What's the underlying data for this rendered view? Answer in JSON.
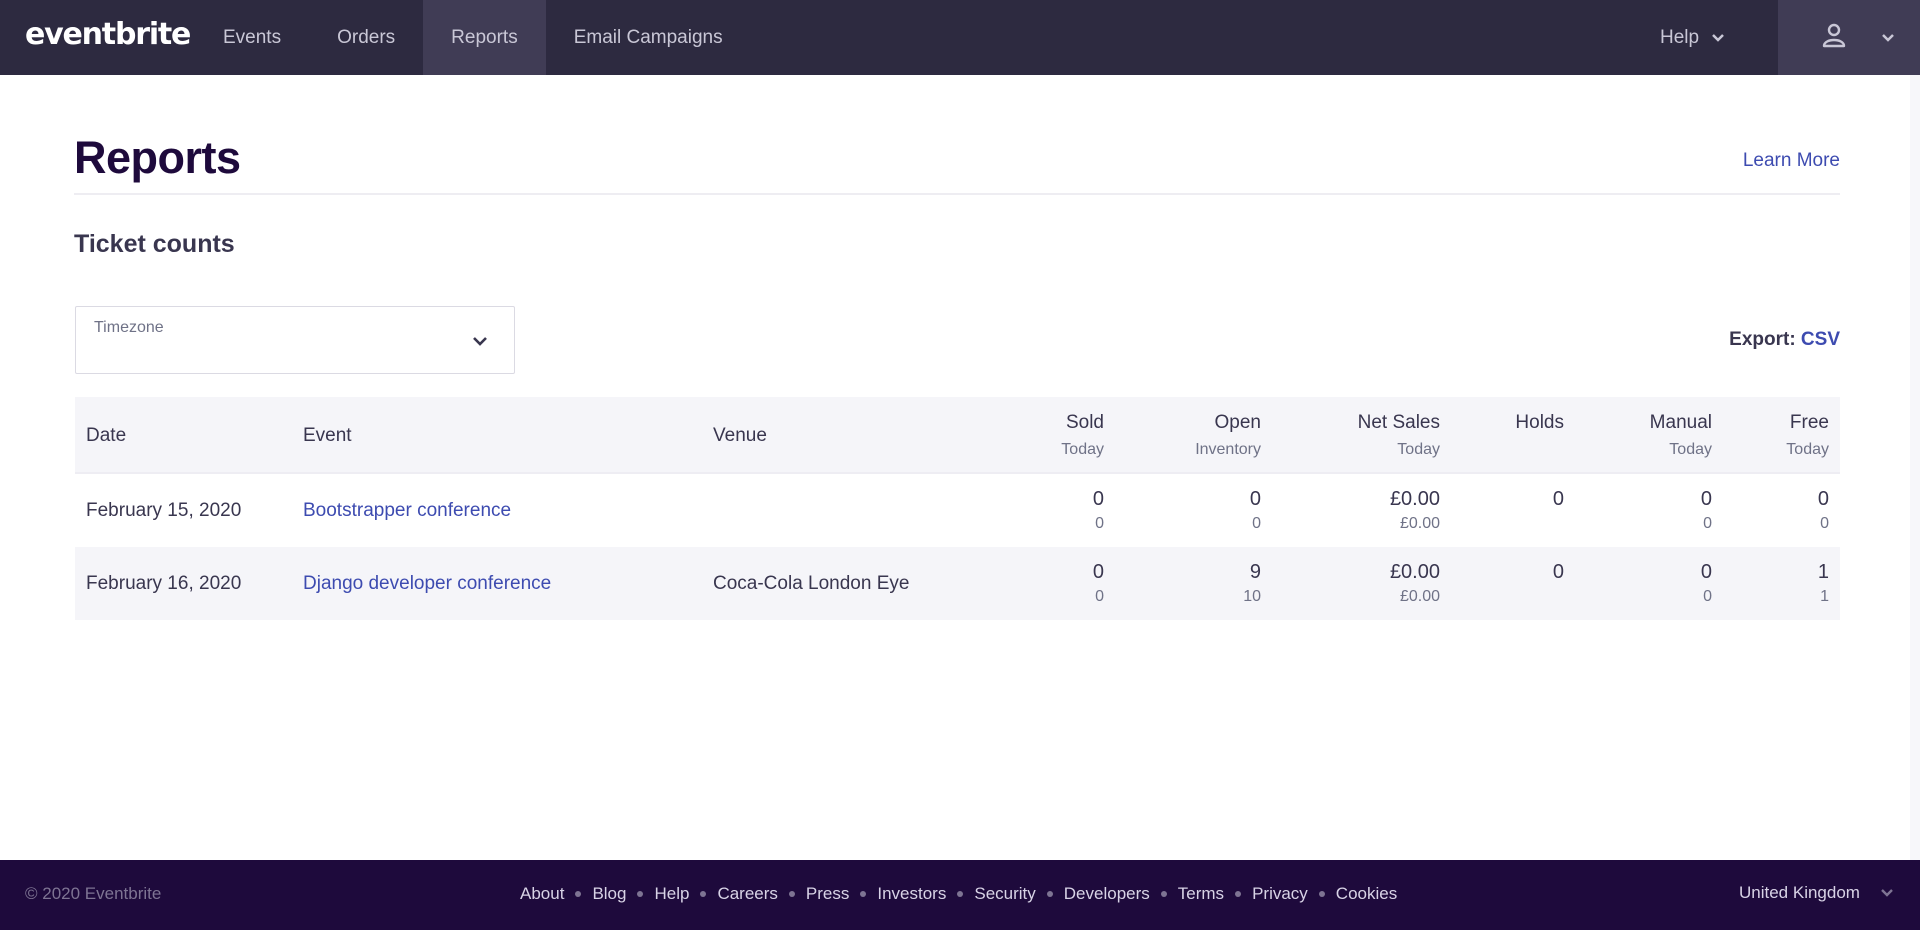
{
  "topbar": {
    "logo": "eventbrite",
    "nav": [
      {
        "label": "Events",
        "active": false
      },
      {
        "label": "Orders",
        "active": false
      },
      {
        "label": "Reports",
        "active": true
      },
      {
        "label": "Email Campaigns",
        "active": false
      }
    ],
    "help_label": "Help",
    "user_icon": "user-icon",
    "chevron_icon": "chevron-down-icon"
  },
  "page": {
    "title": "Reports",
    "learn_more": "Learn More",
    "section_title": "Ticket counts"
  },
  "timezone": {
    "label": "Timezone",
    "value": ""
  },
  "export": {
    "label": "Export:",
    "csv": "CSV"
  },
  "table": {
    "columns": [
      {
        "key": "date",
        "label": "Date",
        "sub": ""
      },
      {
        "key": "event",
        "label": "Event",
        "sub": ""
      },
      {
        "key": "venue",
        "label": "Venue",
        "sub": ""
      },
      {
        "key": "sold",
        "label": "Sold",
        "sub": "Today"
      },
      {
        "key": "open",
        "label": "Open",
        "sub": "Inventory"
      },
      {
        "key": "net",
        "label": "Net Sales",
        "sub": "Today"
      },
      {
        "key": "holds",
        "label": "Holds",
        "sub": ""
      },
      {
        "key": "manual",
        "label": "Manual",
        "sub": "Today"
      },
      {
        "key": "free",
        "label": "Free",
        "sub": "Today"
      }
    ],
    "rows": [
      {
        "date": "February 15, 2020",
        "event": "Bootstrapper conference",
        "venue": "",
        "sold": "0",
        "sold_sub": "0",
        "open": "0",
        "open_sub": "0",
        "net": "£0.00",
        "net_sub": "£0.00",
        "holds": "0",
        "manual": "0",
        "manual_sub": "0",
        "free": "0",
        "free_sub": "0"
      },
      {
        "date": "February 16, 2020",
        "event": "Django developer conference",
        "venue": "Coca-Cola London Eye",
        "sold": "0",
        "sold_sub": "0",
        "open": "9",
        "open_sub": "10",
        "net": "£0.00",
        "net_sub": "£0.00",
        "holds": "0",
        "manual": "0",
        "manual_sub": "0",
        "free": "1",
        "free_sub": "1"
      }
    ]
  },
  "footer": {
    "copyright": "© 2020 Eventbrite",
    "links": [
      "About",
      "Blog",
      "Help",
      "Careers",
      "Press",
      "Investors",
      "Security",
      "Developers",
      "Terms",
      "Privacy",
      "Cookies"
    ],
    "country": "United Kingdom"
  },
  "colors": {
    "topbar_bg": "#2d2a40",
    "active_nav_bg": "#403c55",
    "link": "#3d4bb0",
    "footer_bg": "#1e0a3c",
    "title": "#1e0a3c"
  }
}
